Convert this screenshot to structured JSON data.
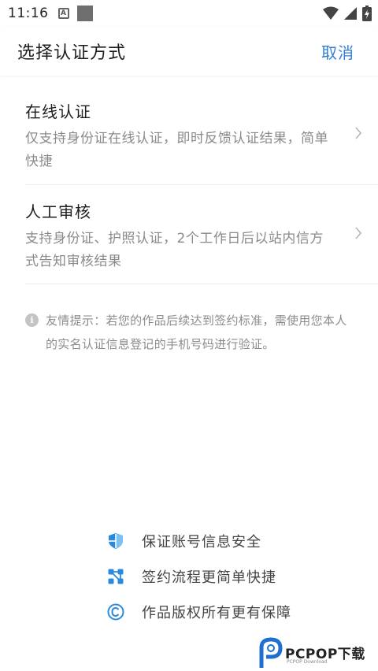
{
  "status_bar": {
    "time": "11:16",
    "a_badge": "A"
  },
  "header": {
    "title": "选择认证方式",
    "cancel_label": "取消"
  },
  "options": [
    {
      "title": "在线认证",
      "description": "仅支持身份证在线认证，即时反馈认证结果，简单快捷"
    },
    {
      "title": "人工审核",
      "description": "支持身份证、护照认证，2个工作日后以站内信方式告知审核结果"
    }
  ],
  "tip": {
    "icon": "info-icon",
    "text": "友情提示：若您的作品后续达到签约标准，需使用您本人的实名认证信息登记的手机号码进行验证。"
  },
  "features": [
    {
      "icon": "shield-icon",
      "label": "保证账号信息安全"
    },
    {
      "icon": "flow-icon",
      "label": "签约流程更简单快捷"
    },
    {
      "icon": "copyright-icon",
      "label": "作品版权所有更有保障"
    }
  ],
  "watermark": {
    "text": "PCPOP下载",
    "sub": "PCPOP Download"
  },
  "colors": {
    "accent": "#2f7fd6",
    "text_primary": "#1e1e1e",
    "text_secondary": "#8a8a8a",
    "icon_blue": "#2a8ae0"
  }
}
